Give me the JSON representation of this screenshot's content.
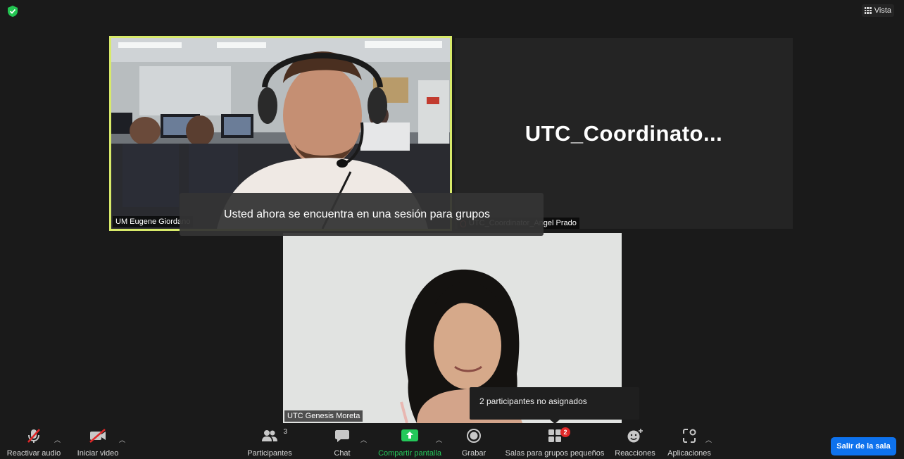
{
  "header": {
    "view_label": "Vista"
  },
  "participants": {
    "eugene": {
      "name": "UM Eugene Giordano"
    },
    "coordinator": {
      "display_name": "UTC_Coordinato...",
      "name_tag": "UTC_Coordinator_Angel Prado"
    },
    "genesis": {
      "name": "UTC Genesis Moreta"
    }
  },
  "notification": {
    "text": "Usted ahora se encuentra en una sesión para grupos"
  },
  "tooltip": {
    "text": "2 participantes no asignados"
  },
  "toolbar": {
    "audio_label": "Reactivar audio",
    "video_label": "Iniciar video",
    "participants_label": "Participantes",
    "participants_count": "3",
    "chat_label": "Chat",
    "share_label": "Compartir pantalla",
    "record_label": "Grabar",
    "breakout_label": "Salas para grupos pequeños",
    "breakout_badge": "2",
    "reactions_label": "Reacciones",
    "apps_label": "Aplicaciones",
    "leave_label": "Salir de la sala"
  },
  "colors": {
    "background": "#1a1a1a",
    "active_speaker_border": "#d8ea6a",
    "share_green": "#24c85a",
    "leave_blue": "#0e72ed",
    "badge_red": "#e02828",
    "shield_green": "#23c552"
  },
  "icons": {
    "shield": "shield-check-icon",
    "view": "grid-view-icon",
    "audio": "microphone-muted-icon",
    "video": "video-camera-off-icon",
    "participants": "people-icon",
    "chat": "chat-bubble-icon",
    "share": "share-screen-up-arrow-icon",
    "record": "record-circle-icon",
    "breakout": "breakout-rooms-grid-icon",
    "reactions": "smiley-plus-icon",
    "apps": "apps-icon"
  }
}
